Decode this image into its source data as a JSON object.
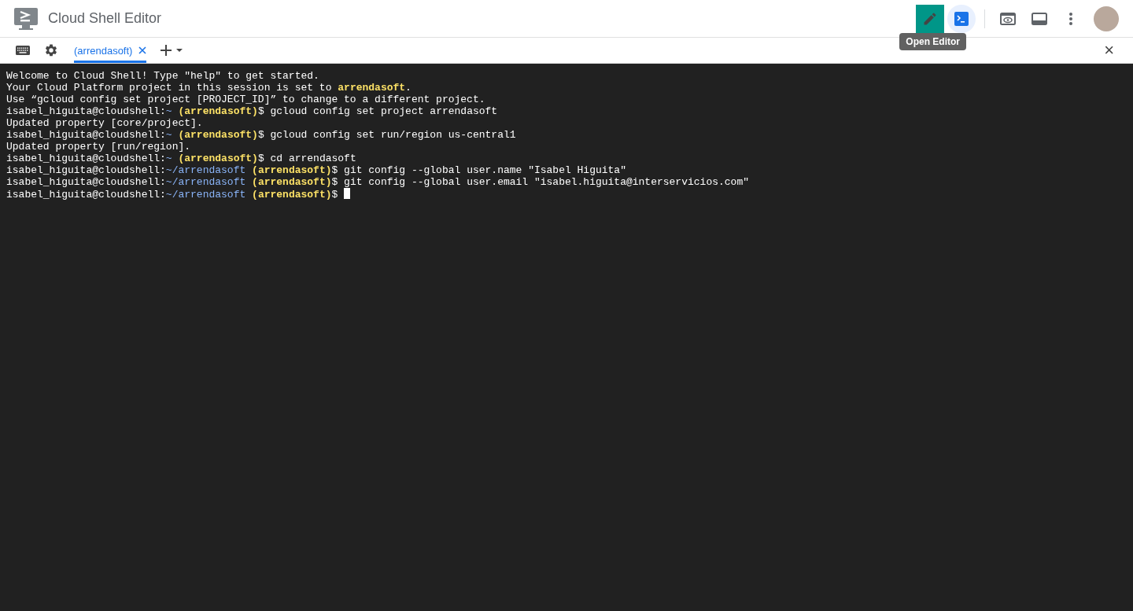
{
  "header": {
    "title": "Cloud Shell Editor",
    "modes": [
      {
        "kind": "edit",
        "focused": true,
        "selected": false
      },
      {
        "kind": "terminal",
        "focused": false,
        "selected": true
      }
    ],
    "actions": [
      {
        "kind": "divider"
      },
      {
        "kind": "preview"
      },
      {
        "kind": "panel"
      },
      {
        "kind": "more"
      },
      {
        "kind": "avatar"
      }
    ],
    "tooltip": "Open Editor"
  },
  "tabbar": {
    "tabs": [
      {
        "label": "(arrendasoft)",
        "selected": true
      }
    ],
    "close_symbol": "×"
  },
  "terminal": {
    "lines": [
      [
        {
          "kind": "text",
          "text": "Welcome to Cloud Shell! Type \"help\" to get started."
        }
      ],
      [
        {
          "kind": "text",
          "text": "Your Cloud Platform project in this session is set to "
        },
        {
          "kind": "project",
          "text": "arrendasoft"
        },
        {
          "kind": "text",
          "text": "."
        }
      ],
      [
        {
          "kind": "text",
          "text": "Use “gcloud config set project [PROJECT_ID]” to change to a different project."
        }
      ],
      [
        {
          "kind": "text",
          "text": "isabel_higuita@cloudshell:"
        },
        {
          "kind": "path",
          "text": "~"
        },
        {
          "kind": "project",
          "text": "(arrendasoft)"
        },
        {
          "kind": "text",
          "text": "$ gcloud config set project arrendasoft"
        }
      ],
      [
        {
          "kind": "text",
          "text": "Updated property [core/project]."
        }
      ],
      [
        {
          "kind": "text",
          "text": "isabel_higuita@cloudshell:"
        },
        {
          "kind": "path",
          "text": "~"
        },
        {
          "kind": "project",
          "text": "(arrendasoft)"
        },
        {
          "kind": "text",
          "text": "$ gcloud config set run/region us-central1"
        }
      ],
      [
        {
          "kind": "text",
          "text": "Updated property [run/region]."
        }
      ],
      [
        {
          "kind": "text",
          "text": "isabel_higuita@cloudshell:"
        },
        {
          "kind": "path",
          "text": "~"
        },
        {
          "kind": "project",
          "text": "(arrendasoft)"
        },
        {
          "kind": "text",
          "text": "$ cd arrendasoft"
        }
      ],
      [
        {
          "kind": "text",
          "text": "isabel_higuita@cloudshell:"
        },
        {
          "kind": "path",
          "text": "~/arrendasoft"
        },
        {
          "kind": "project",
          "text": "(arrendasoft)"
        },
        {
          "kind": "text",
          "text": "$ git config --global user.name \"Isabel Higuita\""
        }
      ],
      [
        {
          "kind": "text",
          "text": "isabel_higuita@cloudshell:"
        },
        {
          "kind": "path",
          "text": "~/arrendasoft"
        },
        {
          "kind": "project",
          "text": "(arrendasoft)"
        },
        {
          "kind": "text",
          "text": "$ git config --global user.email \"isabel.higuita@interservicios.com\""
        }
      ],
      [
        {
          "kind": "text",
          "text": "isabel_higuita@cloudshell:"
        },
        {
          "kind": "path",
          "text": "~/arrendasoft"
        },
        {
          "kind": "project",
          "text": "(arrendasoft)"
        },
        {
          "kind": "text",
          "text": "$"
        },
        {
          "kind": "cursor"
        }
      ]
    ]
  }
}
